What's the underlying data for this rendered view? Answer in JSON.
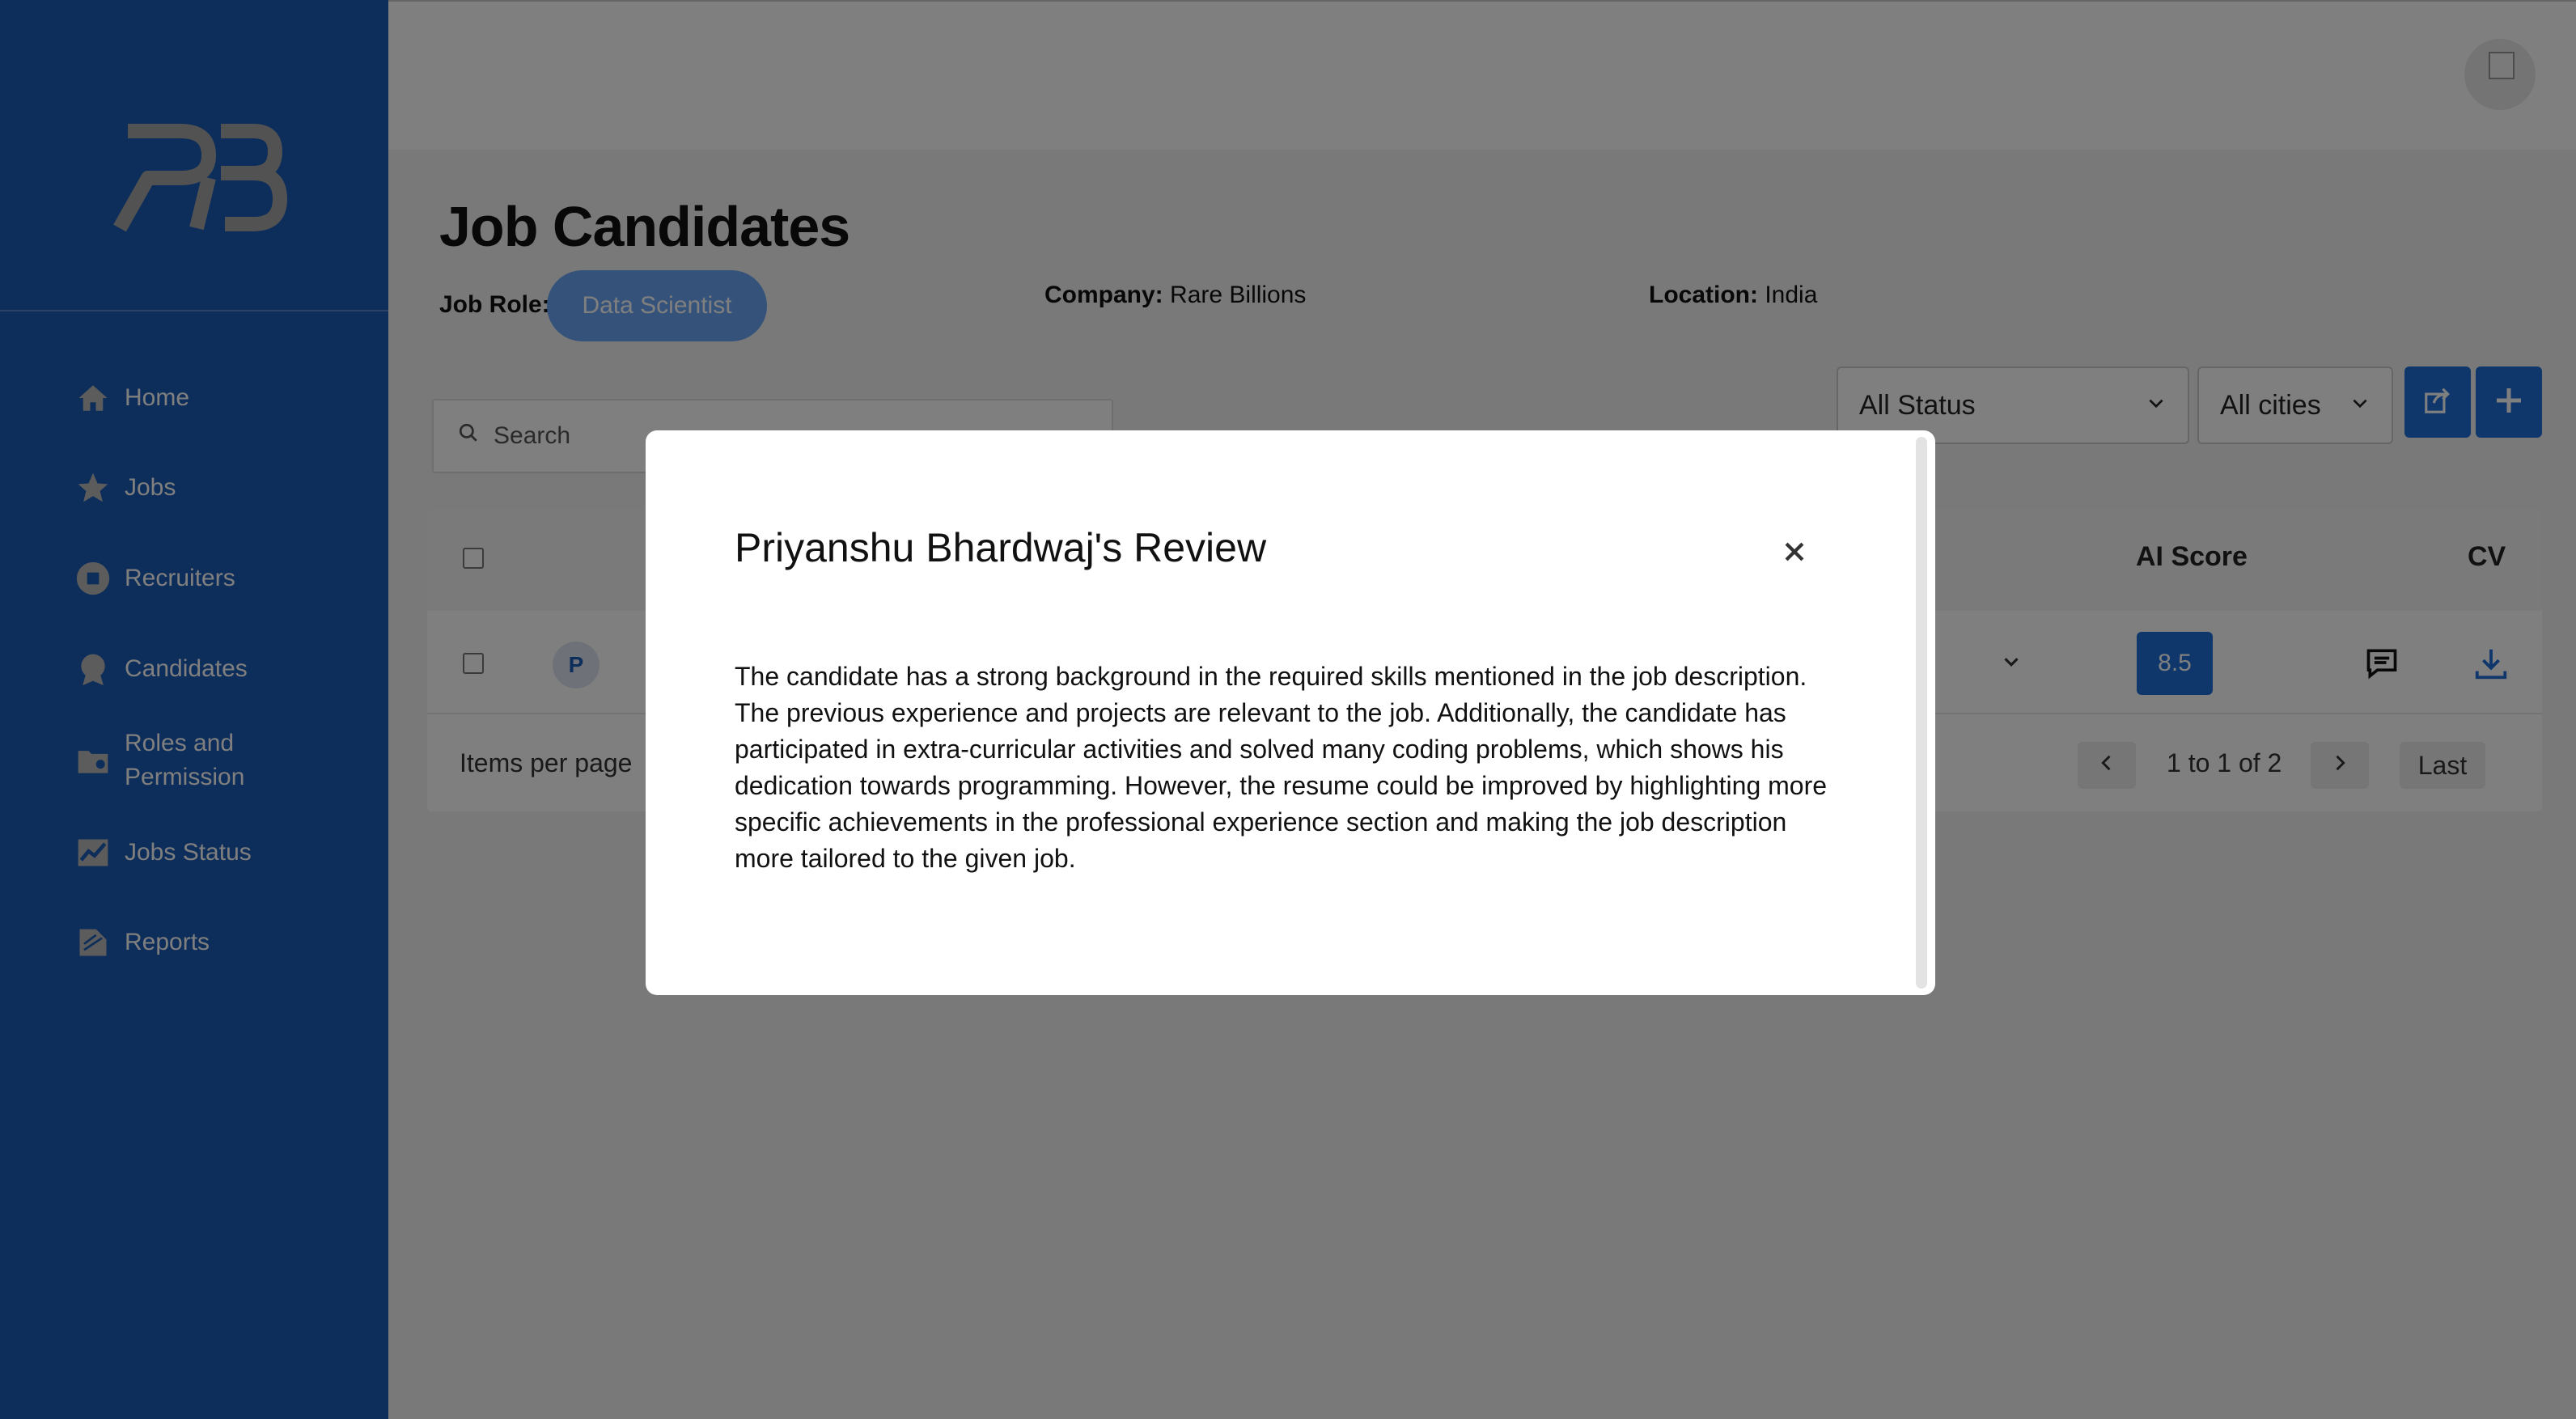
{
  "sidebar": {
    "logo_text": "RB",
    "items": [
      {
        "label": "Home",
        "icon": "home-icon"
      },
      {
        "label": "Jobs",
        "icon": "star-icon"
      },
      {
        "label": "Recruiters",
        "icon": "recruiters-icon"
      },
      {
        "label": "Candidates",
        "icon": "badge-icon"
      },
      {
        "label": "Roles and Permission",
        "icon": "folder-user-icon"
      },
      {
        "label": "Jobs Status",
        "icon": "chart-line-icon"
      },
      {
        "label": "Reports",
        "icon": "reports-icon"
      }
    ]
  },
  "page": {
    "title": "Job Candidates",
    "job_role_label": "Job Role:",
    "job_role_value": "Data Scientist",
    "company_label": "Company:",
    "company_value": "Rare Billions",
    "location_label": "Location:",
    "location_value": "India"
  },
  "filters": {
    "search_placeholder": "Search",
    "status_selected": "All Status",
    "city_selected": "All cities"
  },
  "table": {
    "headers": {
      "ai_score": "AI Score",
      "cv": "CV"
    },
    "row": {
      "initial": "P",
      "ai_score": "8.5"
    },
    "footer": {
      "items_per_page": "Items per page",
      "range": "1 to 1 of 2",
      "last": "Last"
    }
  },
  "modal": {
    "title": "Priyanshu Bhardwaj's Review",
    "body": "The candidate has a strong background in the required skills mentioned in the job description. The previous experience and projects are relevant to the job. Additionally, the candidate has participated in extra-curricular activities and solved many coding problems, which shows his dedication towards programming. However, the resume could be improved by highlighting more specific achievements in the professional experience section and making the job description more tailored to the given job."
  },
  "colors": {
    "sidebar": "#1a5bb5",
    "accent": "#1e6fd9",
    "pill": "#6aa7f4"
  }
}
